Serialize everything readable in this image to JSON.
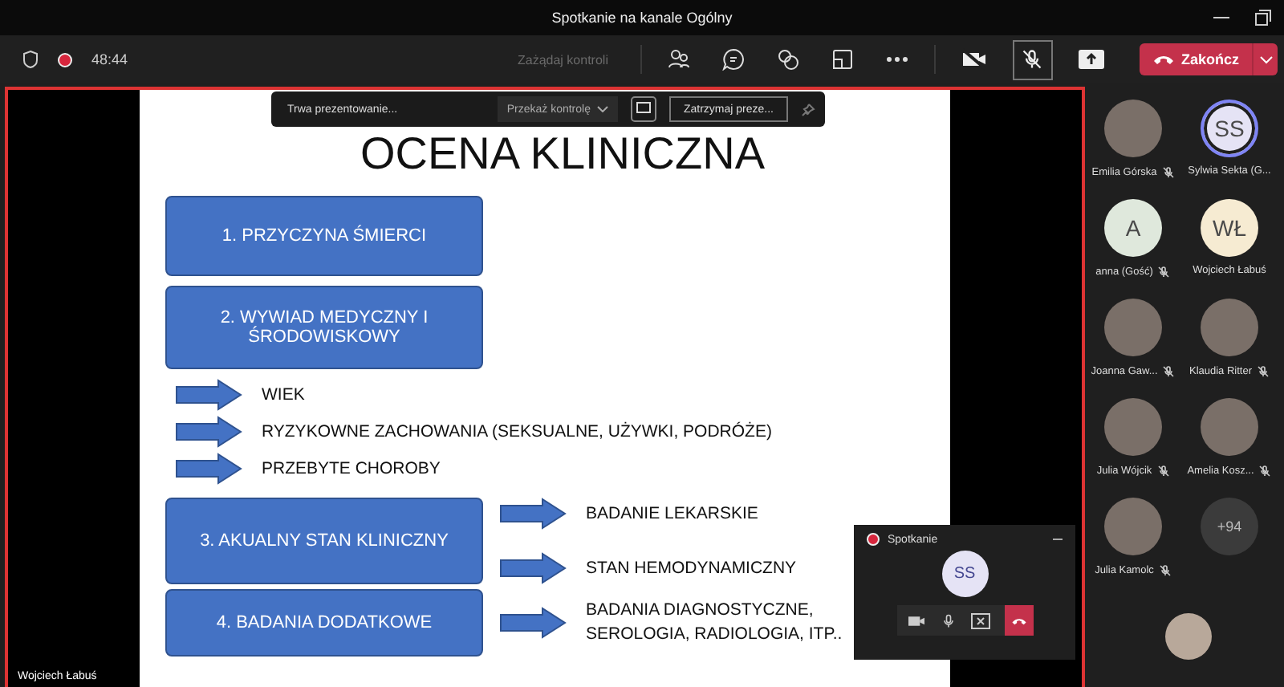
{
  "window": {
    "title": "Spotkanie na kanale Ogólny"
  },
  "toolbar": {
    "timer": "48:44",
    "recording": true,
    "request_control": {
      "label": "Zażądaj kontroli",
      "disabled": true
    },
    "camera_on": false,
    "mic_muted": true,
    "end_button": "Zakończ"
  },
  "sharing_bar": {
    "status": "Trwa prezentowanie...",
    "give_control": "Przekaż kontrolę",
    "stop": "Zatrzymaj preze..."
  },
  "slide": {
    "title": "OCENA KLINICZNA",
    "sections": [
      {
        "box": "1. PRZYCZYNA ŚMIERCI"
      },
      {
        "box": "2. WYWIAD MEDYCZNY I ŚRODOWISKOWY",
        "items": [
          "WIEK",
          "RYZYKOWNE ZACHOWANIA (SEKSUALNE, UŻYWKI, PODRÓŻE)",
          "PRZEBYTE CHOROBY"
        ]
      },
      {
        "box": "3. AKUALNY STAN KLINICZNY",
        "items": [
          "BADANIE LEKARSKIE",
          "STAN HEMODYNAMICZNY"
        ]
      },
      {
        "box": "4. BADANIA DODATKOWE",
        "items": [
          "BADANIA DIAGNOSTYCZNE, SEROLOGIA, RADIOLOGIA, ITP.."
        ]
      }
    ]
  },
  "presenter_label": "Wojciech Łabuś",
  "mini_window": {
    "title": "Spotkanie",
    "initials": "SS"
  },
  "participants": [
    {
      "kind": "photo",
      "name": "Emilia Górska",
      "muted": true,
      "speaking": false
    },
    {
      "kind": "initials",
      "initials": "SS",
      "name": "Sylwia Sekta (G...",
      "muted": false,
      "speaking": true,
      "color": "#e5e3f5"
    },
    {
      "kind": "initials",
      "initials": "A",
      "name": "anna (Gość)",
      "muted": true,
      "speaking": false,
      "color": "#dfe8dc"
    },
    {
      "kind": "initials",
      "initials": "WŁ",
      "name": "Wojciech Łabuś",
      "muted": false,
      "speaking": false,
      "color": "#f6ebd2"
    },
    {
      "kind": "photo",
      "name": "Joanna Gaw...",
      "muted": true,
      "speaking": false
    },
    {
      "kind": "photo",
      "name": "Klaudia Ritter",
      "muted": true,
      "speaking": false
    },
    {
      "kind": "photo",
      "name": "Julia Wójcik",
      "muted": true,
      "speaking": false
    },
    {
      "kind": "photo",
      "name": "Amelia Kosz...",
      "muted": true,
      "speaking": false
    },
    {
      "kind": "photo",
      "name": "Julia Kamolc",
      "muted": true,
      "speaking": false
    },
    {
      "kind": "more",
      "count": "+94"
    }
  ]
}
